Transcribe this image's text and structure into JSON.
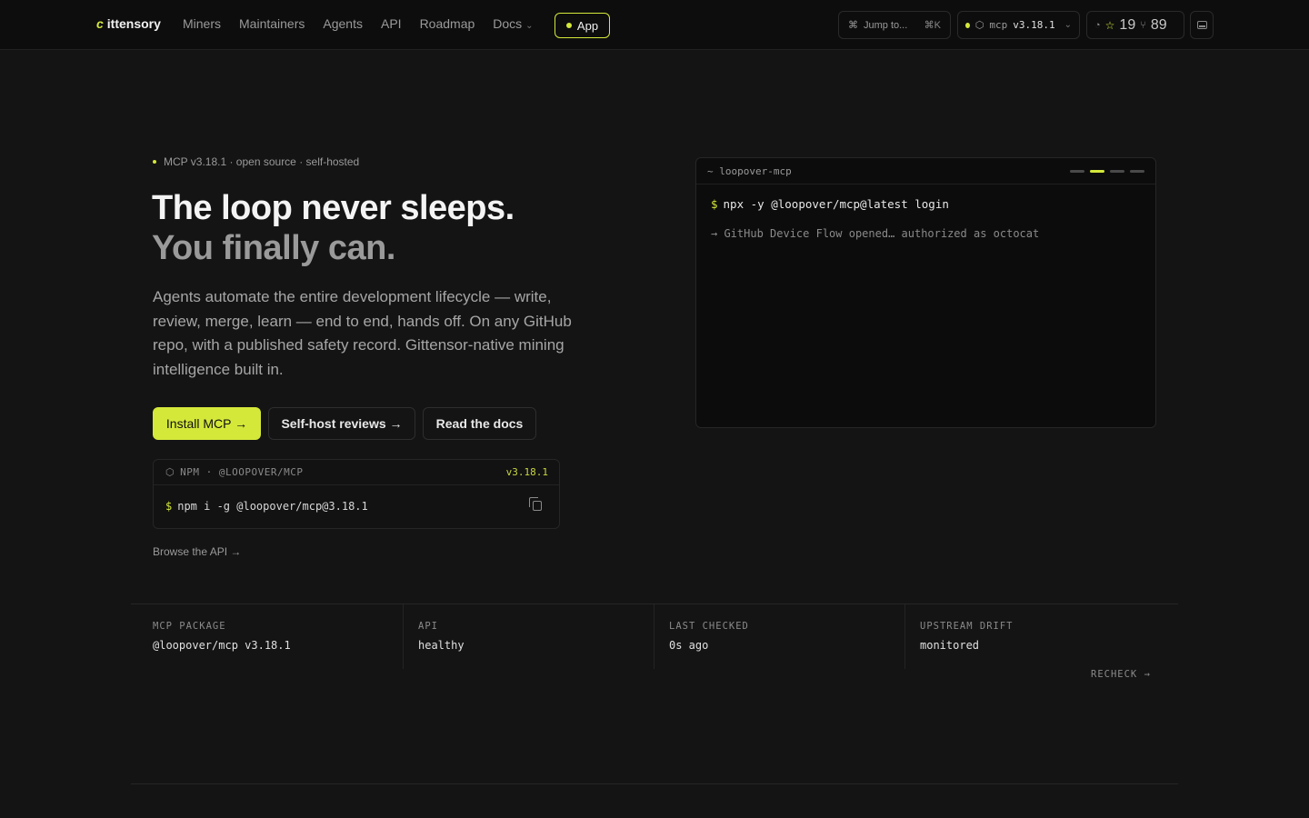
{
  "nav": {
    "logo_mark": "c",
    "logo_text": "ittensory",
    "links": [
      "Miners",
      "Maintainers",
      "Agents",
      "API",
      "Roadmap",
      "Docs"
    ],
    "app_label": "App",
    "jump_label": "Jump to...",
    "jump_kbd": "⌘K",
    "mcp_label": "mcp",
    "mcp_version": "v3.18.1",
    "stars": "19",
    "forks": "89"
  },
  "hero": {
    "eyebrow": "MCP v3.18.1 · open source · self-hosted",
    "title_line1": "The loop never sleeps.",
    "title_line2": "You finally can.",
    "lede": "Agents automate the entire development lifecycle — write, review, merge, learn — end to end, hands off. On any GitHub repo, with a published safety record. Gittensor-native mining intelligence built in.",
    "cta_install": "Install MCP →",
    "cta_selfhost": "Self-host reviews →",
    "cta_docs": "Read the docs",
    "browse_api": "Browse the API →"
  },
  "npm": {
    "label": "NPM · @LOOPOVER/MCP",
    "version": "v3.18.1",
    "prompt": "$",
    "command": "npm i -g @loopover/mcp@3.18.1"
  },
  "terminal": {
    "title": "~ loopover-mcp",
    "prompt": "$",
    "command": "npx -y @loopover/mcp@latest login",
    "output": "→ GitHub Device Flow opened… authorized as octocat",
    "active_step": 2
  },
  "status": {
    "items": [
      {
        "key": "MCP PACKAGE",
        "value": "@loopover/mcp v3.18.1"
      },
      {
        "key": "API",
        "value": "healthy"
      },
      {
        "key": "LAST CHECKED",
        "value": "0s ago"
      },
      {
        "key": "UPSTREAM DRIFT",
        "value": "monitored"
      }
    ],
    "recheck": "RECHECK →"
  },
  "colors": {
    "accent": "#d4e83a",
    "background": "#141414"
  }
}
